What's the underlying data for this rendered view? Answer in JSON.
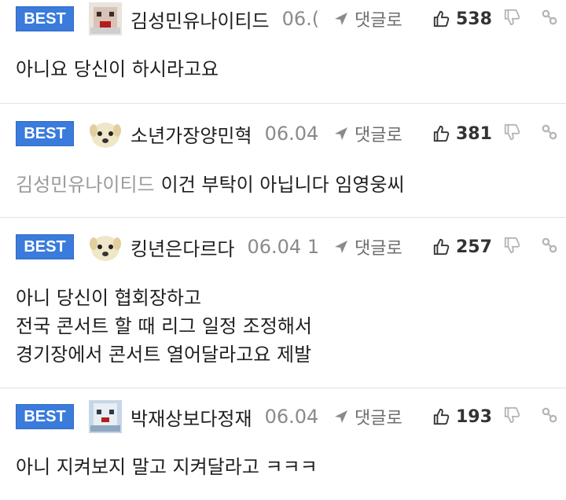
{
  "labels": {
    "best": "BEST",
    "reply": "댓글로"
  },
  "colors": {
    "best_badge": "#3a7bdc",
    "meta_gray": "#8a8a8a"
  },
  "comments": [
    {
      "nickname": "김성민유나이티드",
      "time": "06.(",
      "likes": "538",
      "avatar_icon": "pixel-avatar-icon",
      "mention": "",
      "text": "아니요 당신이 하시라고요"
    },
    {
      "nickname": "소년가장양민혁",
      "time": "06.04",
      "likes": "381",
      "avatar_icon": "dog-avatar-icon",
      "mention": "김성민유나이티드",
      "text": "이건 부탁이 아닙니다 임영웅씨"
    },
    {
      "nickname": "킹년은다르다",
      "time": "06.04 1",
      "likes": "257",
      "avatar_icon": "dog-avatar-icon",
      "mention": "",
      "text": "아니 당신이 협회장하고\n전국 콘서트 할 때 리그 일정 조정해서\n경기장에서 콘서트 열어달라고요 제발"
    },
    {
      "nickname": "박재상보다정재",
      "time": "06.04",
      "likes": "193",
      "avatar_icon": "pixel-avatar-icon",
      "mention": "",
      "text": "아니 지켜보지 말고 지켜달라고 ㅋㅋㅋ"
    }
  ]
}
